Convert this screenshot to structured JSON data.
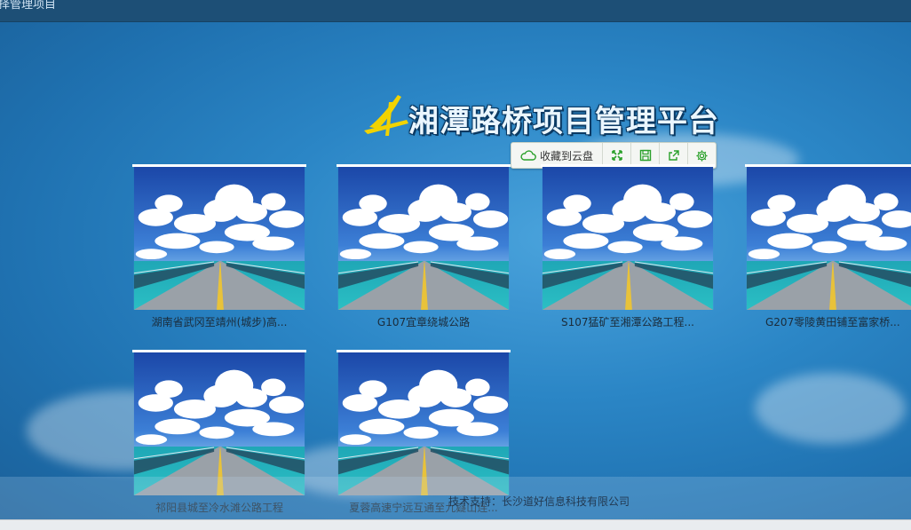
{
  "window": {
    "title": "择管理项目"
  },
  "header": {
    "platform_title": "湘潭路桥项目管理平台"
  },
  "toolbar": {
    "save_label": "收藏到云盘"
  },
  "projects": [
    {
      "name": "湖南省武冈至靖州(城步)高..."
    },
    {
      "name": "G107宜章绕城公路"
    },
    {
      "name": "S107猛矿至湘潭公路工程..."
    },
    {
      "name": "G207零陵黄田铺至富家桥..."
    },
    {
      "name": "祁阳县城至冷水滩公路工程"
    },
    {
      "name": "夏蓉高速宁远互通至九嶷山连..."
    }
  ],
  "footer": {
    "support": "技术支持：长沙道好信息科技有限公司"
  },
  "colors": {
    "toolbar_icon": "#2aa02a",
    "logo_yellow": "#f2d300"
  }
}
